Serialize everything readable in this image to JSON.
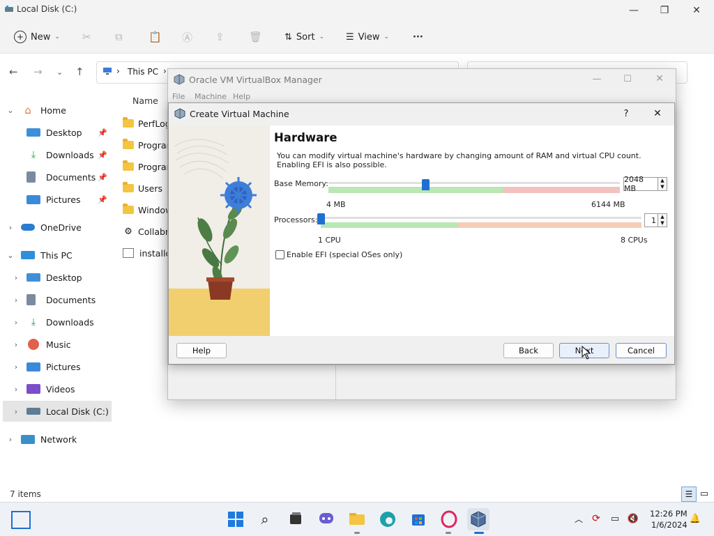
{
  "explorer": {
    "title": "Local Disk (C:)",
    "toolbar": {
      "new_label": "New",
      "sort_label": "Sort",
      "view_label": "View",
      "more_label": "···"
    },
    "breadcrumb": {
      "this_pc": "This PC",
      "sep": "›"
    },
    "column_name": "Name",
    "sidebar": [
      {
        "label": "Home",
        "icon": "home-icon"
      },
      {
        "label": "Desktop",
        "icon": "desktop-icon"
      },
      {
        "label": "Downloads",
        "icon": "download-icon"
      },
      {
        "label": "Documents",
        "icon": "documents-icon"
      },
      {
        "label": "Pictures",
        "icon": "pictures-icon"
      },
      {
        "label": "OneDrive",
        "icon": "cloud-icon"
      },
      {
        "label": "This PC",
        "icon": "computer-icon"
      },
      {
        "label": "Desktop",
        "icon": "desktop-icon"
      },
      {
        "label": "Documents",
        "icon": "documents-icon"
      },
      {
        "label": "Downloads",
        "icon": "download-icon"
      },
      {
        "label": "Music",
        "icon": "music-icon"
      },
      {
        "label": "Pictures",
        "icon": "pictures-icon"
      },
      {
        "label": "Videos",
        "icon": "videos-icon"
      },
      {
        "label": "Local Disk (C:)",
        "icon": "drive-icon"
      },
      {
        "label": "Network",
        "icon": "network-icon"
      }
    ],
    "files": [
      "PerfLog",
      "Program",
      "Program",
      "Users",
      "Window",
      "Collabn",
      "installce"
    ],
    "status": "7 items"
  },
  "vbox_manager": {
    "title": "Oracle VM VirtualBox Manager",
    "menu": [
      "File",
      "Machine",
      "Help"
    ]
  },
  "dialog": {
    "title": "Create Virtual Machine",
    "help_glyph": "?",
    "close_glyph": "✕",
    "heading": "Hardware",
    "desc_line1": "You can modify virtual machine's hardware by changing amount of RAM and virtual CPU count.",
    "desc_line2": "Enabling EFI is also possible.",
    "memory": {
      "label": "Base Memory:",
      "value": "2048 MB",
      "min_label": "4 MB",
      "max_label": "6144 MB",
      "fraction": 0.333
    },
    "processors": {
      "label": "Processors:",
      "value": "1",
      "min_label": "1 CPU",
      "max_label": "8 CPUs",
      "fraction": 0
    },
    "efi_label": "Enable EFI (special OSes only)",
    "buttons": {
      "help": "Help",
      "back": "Back",
      "next": "Next",
      "cancel": "Cancel"
    }
  },
  "taskbar": {
    "time": "12:26 PM",
    "date": "1/6/2024"
  }
}
